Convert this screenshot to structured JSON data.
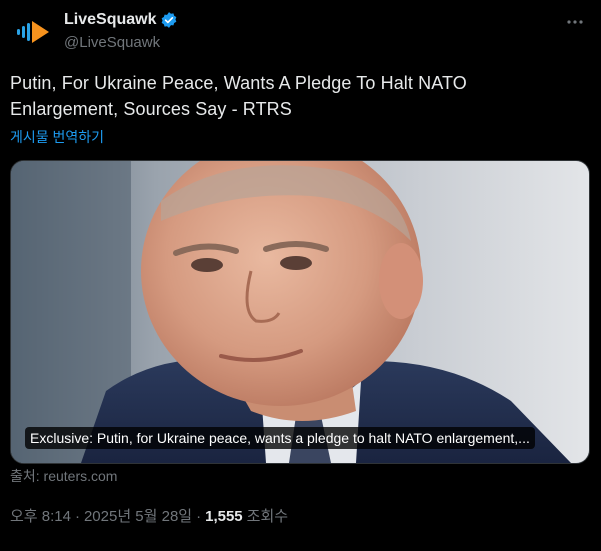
{
  "author": {
    "name": "LiveSquawk",
    "handle": "@LiveSquawk",
    "verified": true,
    "accent_color": "#f7931e"
  },
  "tweet": {
    "text": "Putin, For Ukraine Peace, Wants A Pledge To Halt NATO Enlargement, Sources Say - RTRS",
    "translate_label": "게시물 번역하기"
  },
  "card": {
    "caption": "Exclusive: Putin, for Ukraine peace, wants a pledge to halt NATO enlargement,...",
    "source": "출처: reuters.com"
  },
  "meta": {
    "time": "오후 8:14",
    "separator": "·",
    "date": "2025년 5월 28일",
    "views_count": "1,555",
    "views_label": "조회수"
  },
  "icons": {
    "avatar": "livesquawk-logo-icon",
    "verified": "verified-badge-icon",
    "more": "more-horizontal-icon"
  },
  "colors": {
    "background": "#000000",
    "text": "#e7e9ea",
    "secondary": "#71767b",
    "link": "#1d9bf0",
    "verified": "#1d9bf0"
  }
}
